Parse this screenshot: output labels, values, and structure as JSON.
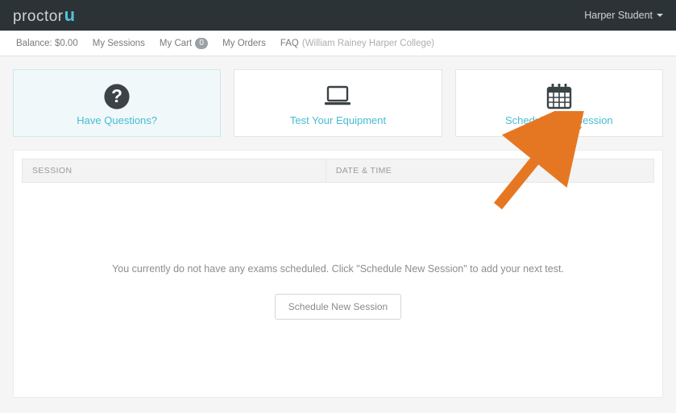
{
  "brand": {
    "prefix": "proctor",
    "suffix": "u"
  },
  "user": {
    "display_name": "Harper Student"
  },
  "subnav": {
    "balance_label": "Balance: $0.00",
    "my_sessions": "My Sessions",
    "my_cart": "My Cart",
    "cart_count": "0",
    "my_orders": "My Orders",
    "faq": "FAQ",
    "institution": "(William Rainey Harper College)"
  },
  "cards": {
    "have_questions": "Have Questions?",
    "test_equipment": "Test Your Equipment",
    "schedule_new": "Schedule New Session"
  },
  "table": {
    "col_session": "SESSION",
    "col_datetime": "DATE & TIME"
  },
  "empty_state": {
    "message": "You currently do not have any exams scheduled. Click \"Schedule New Session\" to add your next test.",
    "button": "Schedule New Session"
  },
  "colors": {
    "accent": "#47bcd3",
    "arrow": "#e67722"
  }
}
